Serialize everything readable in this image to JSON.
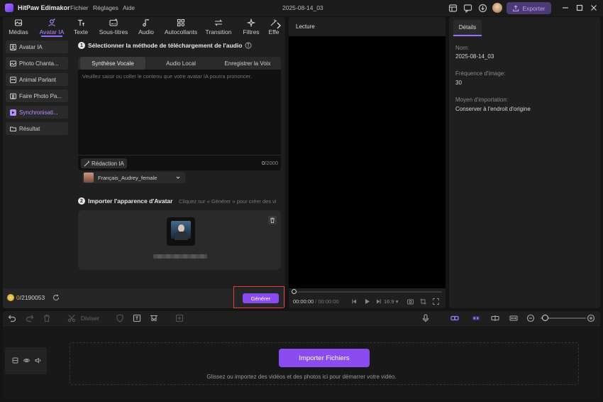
{
  "titlebar": {
    "app_name": "HitPaw Edimakor",
    "menu": [
      "Fichier",
      "Réglages",
      "Aide"
    ],
    "document_title": "2025-08-14_03",
    "export_label": "Exporter"
  },
  "toolbar": {
    "tabs": [
      {
        "label": "Médias",
        "icon": "media-icon"
      },
      {
        "label": "Avatar IA",
        "icon": "ai-avatar-icon",
        "active": true
      },
      {
        "label": "Texte",
        "icon": "text-icon"
      },
      {
        "label": "Sous-titres",
        "icon": "subtitles-icon"
      },
      {
        "label": "Audio",
        "icon": "music-note-icon"
      },
      {
        "label": "Autocollants",
        "icon": "stickers-icon"
      },
      {
        "label": "Transition",
        "icon": "transition-icon"
      },
      {
        "label": "Filtres",
        "icon": "filters-icon"
      },
      {
        "label": "Effe",
        "icon": "effects-icon"
      }
    ]
  },
  "sidebar": {
    "items": [
      {
        "label": "Avatar IA",
        "icon": "avatar-icon"
      },
      {
        "label": "Photo Chanta...",
        "icon": "photo-icon"
      },
      {
        "label": "Animal Parlant",
        "icon": "animal-icon"
      },
      {
        "label": "Faire Photo Pa...",
        "icon": "photo-talk-icon"
      },
      {
        "label": "Synchronisati...",
        "icon": "sync-icon",
        "active": true
      },
      {
        "label": "Résultat",
        "icon": "folder-icon"
      }
    ]
  },
  "step1": {
    "number": "1",
    "title": "Sélectionner la méthode de téléchargement de l'audio",
    "tabs": [
      "Synthèse Vocale",
      "Audio Local",
      "Enregistrer la Voix"
    ],
    "placeholder": "Veuillez saisir ou coller le contenu que votre avatar IA pourra prononcer.",
    "redaction_label": "Rédaction IA",
    "char_count": "0",
    "char_max": "/2000",
    "voice": "Français_Audrey_female"
  },
  "step2": {
    "number": "2",
    "title": "Importer l'apparence d'Avatar",
    "hint": "Cliquez sur « Générer » pour créer des vi"
  },
  "footer": {
    "credits_used": "0",
    "credits_total": "/2190053",
    "generate_label": "Générer"
  },
  "preview": {
    "title": "Lecture",
    "time_current": "00:00:00",
    "time_total": "/ 00:00:00",
    "ratio": "16:9"
  },
  "details": {
    "tab": "Détails",
    "name_label": "Nom:",
    "name_value": "2025-08-14_03",
    "fps_label": "Fréquence d'image:",
    "fps_value": "30",
    "import_label": "Moyen d'importation:",
    "import_value": "Conserver à l'endroit d'origine"
  },
  "timeline": {
    "split_label": "Diviser",
    "import_button": "Importer Fichiers",
    "drop_hint": "Glissez ou importez des vidéos et des photos ici pour démarrer votre vidéo."
  },
  "colors": {
    "accent": "#8a4cf0",
    "highlight_frame": "#e0423a",
    "credits": "#e6a43a"
  }
}
